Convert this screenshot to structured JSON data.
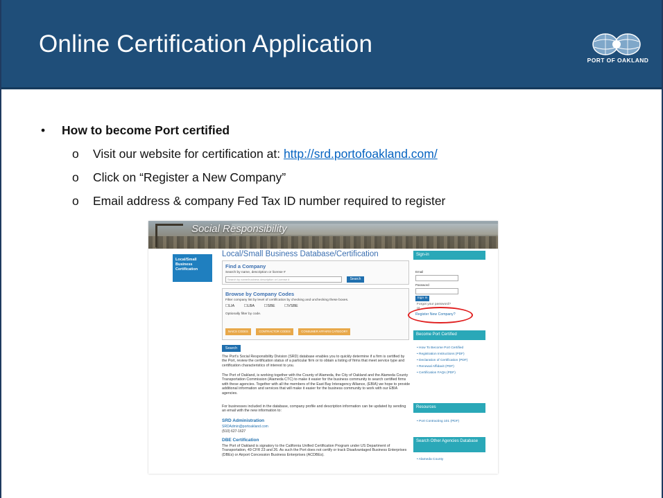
{
  "slide": {
    "title": "Online Certification Application",
    "logo_text": "PORT OF OAKLAND",
    "bullet": {
      "marker": "•",
      "text": "How to become Port certified",
      "subs": [
        {
          "marker": "o",
          "text": "Visit our website for certification at: ",
          "link": "http://srd.portofoakland.com/"
        },
        {
          "marker": "o",
          "text": "Click on “Register a New Company”"
        },
        {
          "marker": "o",
          "text": "Email address & company Fed Tax ID number required to register"
        }
      ]
    }
  },
  "website": {
    "banner_title": "Social Responsibility",
    "nav_box": [
      "Local/Small",
      "Business",
      "Certification"
    ],
    "main_title": "Local/Small Business Database/Certification",
    "find": {
      "heading": "Find a Company",
      "sub": "Search by name, description or license #",
      "placeholder": "Search by name/business description or License #",
      "button": "Search"
    },
    "browse": {
      "heading": "Browse by Company Codes",
      "sub": "Filter company list by level of certification by checking and unchecking these boxes.",
      "checkboxes": [
        "LIA",
        "LBA",
        "SBE",
        "VSBE"
      ],
      "filter_label": "Optionally filter by code.",
      "code_buttons": [
        "NAICS CODES",
        "CONTRACTOR CODES",
        "CONSUMER AFFAIRS CATEGORY"
      ]
    },
    "search_button": "Search",
    "paragraphs": [
      "The Port's Social Responsibility Division (SRD) database enables you to quickly determine if a firm is certified by the Port, review the certification status of a particular firm or to obtain a listing of firms that meet service type and certification characteristics of interest to you.",
      "The Port of Oakland, is working together with the County of Alameda, the City of Oakland and the Alameda County Transportation Commission (Alameda CTC) to make it easier for the business community to search certified firms with these agencies. Together with all the members of the East Bay Interagency Alliance, (EBIA) we hope to provide additional information and services that will make it easier for the business community to work with our EBIA agencies.",
      "For businesses included in the database, company profile and description information can be updated by sending an email with the new information to:"
    ],
    "srd": {
      "heading": "SRD Administration",
      "email": "SRDAdmin@portoakland.com",
      "phone": "(510) 627-1627"
    },
    "dbe": {
      "heading": "DBE Certification",
      "text": "The Port of Oakland is signatory to the California Unified Certification Program under US Department of Transportation, 49 CFR 23 and 26. As such the Port does not certify or track Disadvantaged Business Enterprises (DBEs) or Airport Concession Business Enterprises (ACDBEs)."
    },
    "sidebar": {
      "sign_in": "Sign-in",
      "email_label": "Email",
      "password_label": "Password",
      "sign_in_button": "Sign In",
      "or_text": "Forgot your password?",
      "or": "or",
      "register_link": "Register New Company?",
      "become_heading": "Become Port Certified",
      "become_links": [
        "How To Become Port Certified",
        "Registration Instructions (PDF)",
        "Declaration of Certification (PDF)",
        "Renewal Affidavit (PDF)",
        "Certification FAQs (PDF)"
      ],
      "resources_heading": "Resources",
      "resources_links": [
        "Port Contracting 101 (PDF)"
      ],
      "other_heading": "Search Other Agencies Database",
      "other_links": [
        "Alameda County"
      ]
    }
  }
}
